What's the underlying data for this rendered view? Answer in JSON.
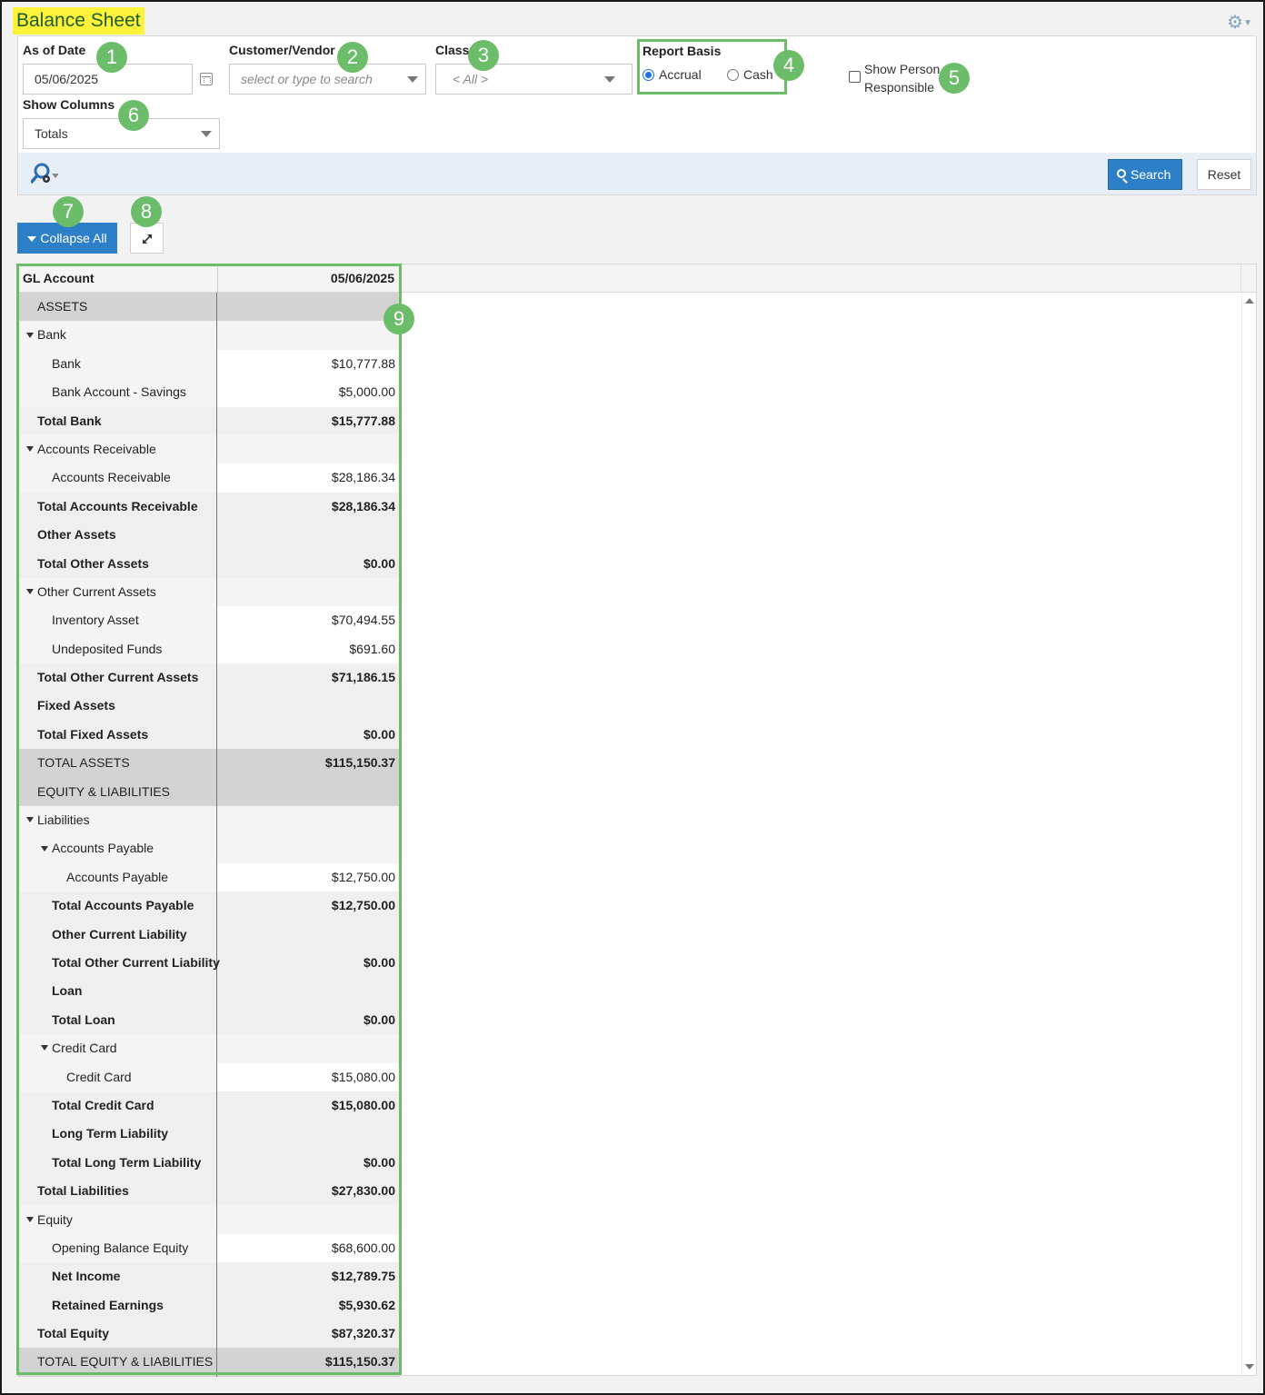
{
  "title": "Balance Sheet",
  "settings_icon": "gear-icon",
  "filters": {
    "as_of_date": {
      "label": "As of Date",
      "value": "05/06/2025"
    },
    "customer_vendor": {
      "label": "Customer/Vendor",
      "placeholder": "select or type to search"
    },
    "class": {
      "label": "Class",
      "value": "< All >"
    },
    "report_basis": {
      "label": "Report Basis",
      "options": [
        "Accrual",
        "Cash"
      ],
      "selected": "Accrual"
    },
    "show_person_responsible": {
      "label_line1": "Show Person",
      "label_line2": "Responsible",
      "checked": false
    },
    "show_columns": {
      "label": "Show Columns",
      "value": "Totals"
    }
  },
  "toolbar": {
    "search_label": "Search",
    "reset_label": "Reset"
  },
  "actions": {
    "collapse_all_label": "Collapse All"
  },
  "badges": [
    "1",
    "2",
    "3",
    "4",
    "5",
    "6",
    "7",
    "8",
    "9"
  ],
  "colors": {
    "accent": "#2d7fc8",
    "highlight": "#6cbd6a",
    "title_bg": "#fff23a"
  },
  "table": {
    "columns": [
      "GL Account",
      "05/06/2025"
    ],
    "rows": [
      {
        "type": "section",
        "indent": 1,
        "label": "ASSETS",
        "value": ""
      },
      {
        "type": "group",
        "indent": 0,
        "toggle": true,
        "label": "Bank",
        "value": ""
      },
      {
        "type": "data",
        "indent": 2,
        "label": "Bank",
        "value": "$10,777.88"
      },
      {
        "type": "data",
        "indent": 2,
        "label": "Bank Account - Savings",
        "value": "$5,000.00"
      },
      {
        "type": "total",
        "indent": 1,
        "label": "Total Bank",
        "value": "$15,777.88"
      },
      {
        "type": "group",
        "indent": 0,
        "toggle": true,
        "label": "Accounts Receivable",
        "value": ""
      },
      {
        "type": "data",
        "indent": 2,
        "label": "Accounts Receivable",
        "value": "$28,186.34"
      },
      {
        "type": "total",
        "indent": 1,
        "label": "Total Accounts Receivable",
        "value": "$28,186.34"
      },
      {
        "type": "total",
        "indent": 1,
        "label": "Other Assets",
        "value": ""
      },
      {
        "type": "total",
        "indent": 1,
        "label": "Total Other Assets",
        "value": "$0.00"
      },
      {
        "type": "group",
        "indent": 0,
        "toggle": true,
        "label": "Other Current Assets",
        "value": ""
      },
      {
        "type": "data",
        "indent": 2,
        "label": "Inventory Asset",
        "value": "$70,494.55"
      },
      {
        "type": "data",
        "indent": 2,
        "label": "Undeposited Funds",
        "value": "$691.60"
      },
      {
        "type": "total",
        "indent": 1,
        "label": "Total Other Current Assets",
        "value": "$71,186.15"
      },
      {
        "type": "total",
        "indent": 1,
        "label": "Fixed Assets",
        "value": ""
      },
      {
        "type": "total",
        "indent": 1,
        "label": "Total Fixed Assets",
        "value": "$0.00"
      },
      {
        "type": "section",
        "indent": 1,
        "label": "TOTAL ASSETS",
        "value": "$115,150.37",
        "bold_value": true
      },
      {
        "type": "section",
        "indent": 1,
        "label": "EQUITY & LIABILITIES",
        "value": ""
      },
      {
        "type": "group",
        "indent": 0,
        "toggle": true,
        "label": "Liabilities",
        "value": ""
      },
      {
        "type": "group",
        "indent": 1,
        "toggle": true,
        "label": "Accounts Payable",
        "value": ""
      },
      {
        "type": "data",
        "indent": 3,
        "label": "Accounts Payable",
        "value": "$12,750.00"
      },
      {
        "type": "total",
        "indent": 2,
        "label": "Total Accounts Payable",
        "value": "$12,750.00"
      },
      {
        "type": "total",
        "indent": 2,
        "label": "Other Current Liability",
        "value": ""
      },
      {
        "type": "total",
        "indent": 2,
        "label": "Total Other Current Liability",
        "value": "$0.00"
      },
      {
        "type": "total",
        "indent": 2,
        "label": "Loan",
        "value": ""
      },
      {
        "type": "total",
        "indent": 2,
        "label": "Total Loan",
        "value": "$0.00"
      },
      {
        "type": "group",
        "indent": 1,
        "toggle": true,
        "label": "Credit Card",
        "value": ""
      },
      {
        "type": "data",
        "indent": 3,
        "label": "Credit Card",
        "value": "$15,080.00"
      },
      {
        "type": "total",
        "indent": 2,
        "label": "Total Credit Card",
        "value": "$15,080.00"
      },
      {
        "type": "total",
        "indent": 2,
        "label": "Long Term Liability",
        "value": ""
      },
      {
        "type": "total",
        "indent": 2,
        "label": "Total Long Term Liability",
        "value": "$0.00"
      },
      {
        "type": "total",
        "indent": 1,
        "label": "Total Liabilities",
        "value": "$27,830.00"
      },
      {
        "type": "group",
        "indent": 0,
        "toggle": true,
        "label": "Equity",
        "value": ""
      },
      {
        "type": "data",
        "indent": 2,
        "label": "Opening Balance Equity",
        "value": "$68,600.00"
      },
      {
        "type": "total",
        "indent": 2,
        "label": "Net Income",
        "value": "$12,789.75"
      },
      {
        "type": "total",
        "indent": 2,
        "label": "Retained Earnings",
        "value": "$5,930.62"
      },
      {
        "type": "total",
        "indent": 1,
        "label": "Total Equity",
        "value": "$87,320.37"
      },
      {
        "type": "section",
        "indent": 1,
        "label": "TOTAL EQUITY & LIABILITIES",
        "value": "$115,150.37",
        "bold_value": true
      }
    ]
  }
}
